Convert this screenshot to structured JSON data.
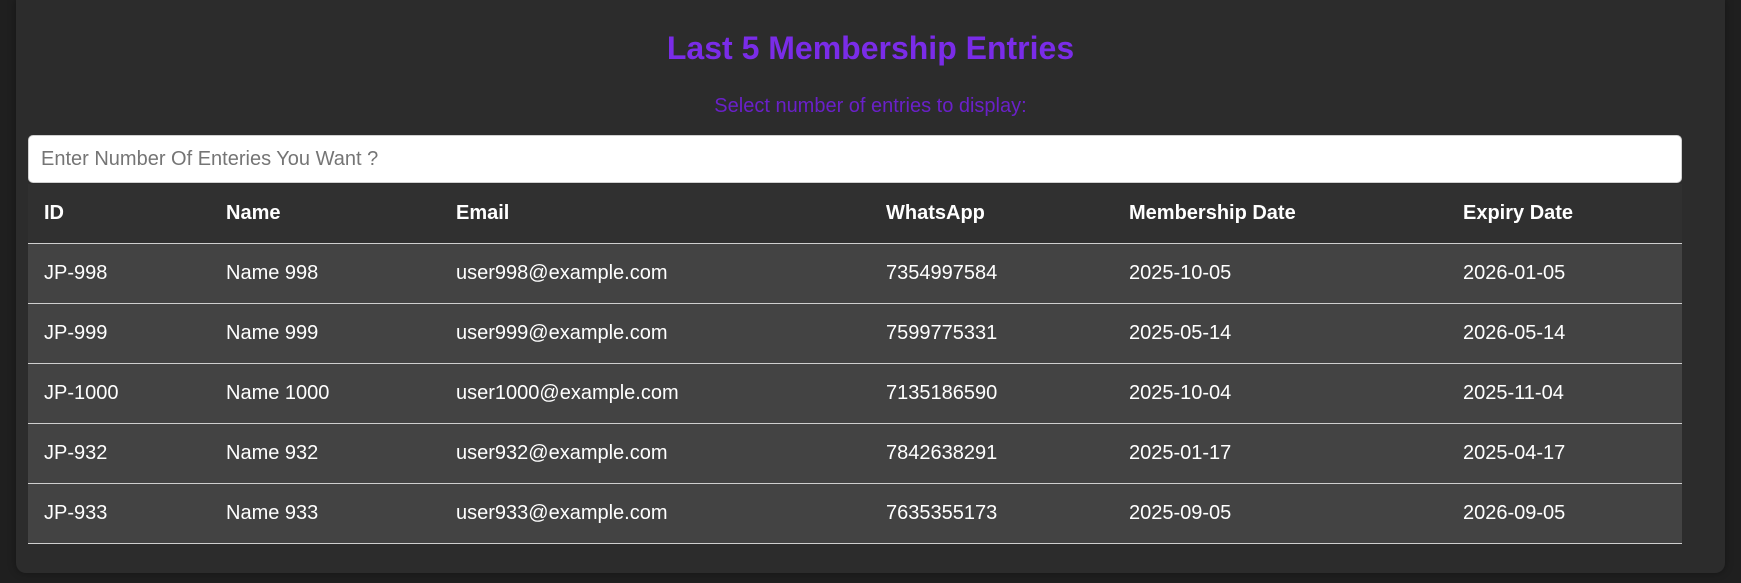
{
  "header": {
    "title": "Last 5 Membership Entries",
    "subtitle": "Select number of entries to display:"
  },
  "entries_input": {
    "placeholder": "Enter Number Of Enteries You Want ?",
    "value": ""
  },
  "table": {
    "columns": [
      "ID",
      "Name",
      "Email",
      "WhatsApp",
      "Membership Date",
      "Expiry Date"
    ],
    "rows": [
      [
        "JP-998",
        "Name 998",
        "user998@example.com",
        "7354997584",
        "2025-10-05",
        "2026-01-05"
      ],
      [
        "JP-999",
        "Name 999",
        "user999@example.com",
        "7599775331",
        "2025-05-14",
        "2026-05-14"
      ],
      [
        "JP-1000",
        "Name 1000",
        "user1000@example.com",
        "7135186590",
        "2025-10-04",
        "2025-11-04"
      ],
      [
        "JP-932",
        "Name 932",
        "user932@example.com",
        "7842638291",
        "2025-01-17",
        "2025-04-17"
      ],
      [
        "JP-933",
        "Name 933",
        "user933@example.com",
        "7635355173",
        "2025-09-05",
        "2026-09-05"
      ]
    ]
  },
  "colors": {
    "title": "#7a2ce8",
    "subtitle": "#6a20c9",
    "card_bg": "#2c2c2c",
    "header_row_bg": "#303030",
    "body_row_bg": "#434343"
  }
}
